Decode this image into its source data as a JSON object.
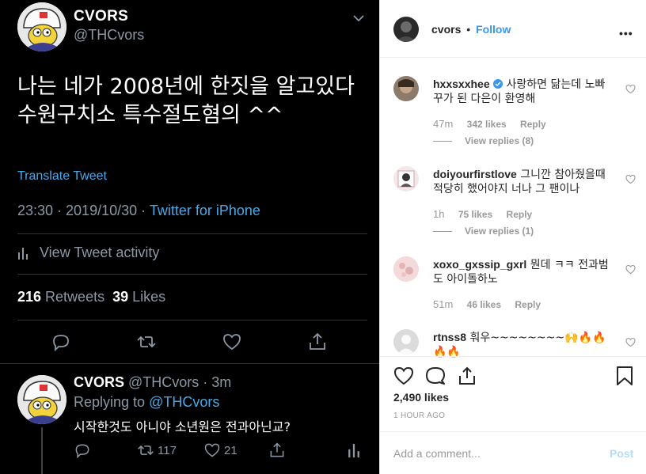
{
  "tweet": {
    "display_name": "CVORS",
    "handle": "@THCvors",
    "text_line1": "나는 네가 2008년에 한짓을 알고있다",
    "text_line2": "수원구치소 특수절도혐의 ^^",
    "translate": "Translate Tweet",
    "timestamp": "23:30 · 2019/10/30 · ",
    "source": "Twitter for iPhone",
    "activity": "View Tweet activity",
    "retweets_count": "216",
    "retweets_label": " Retweets  ",
    "likes_count": "39",
    "likes_label": " Likes"
  },
  "reply": {
    "display_name": "CVORS",
    "handle_time": " @THCvors · 3m",
    "replying_label": "Replying to ",
    "replying_mention": "@THCvors",
    "text": "시작한것도 아니야 소년원은 전과아닌교?",
    "retweets": "117",
    "likes": "21"
  },
  "instagram": {
    "username": "cvors",
    "separator": "•",
    "follow_label": "Follow",
    "more": "•••",
    "comments": [
      {
        "user": "hxxsxxhee",
        "verified": true,
        "text": "사랑하면 닮는데 노빠꾸가 된 다은이 환영해",
        "time": "47m",
        "likes": "342 likes",
        "reply": "Reply",
        "view_replies": "View replies (8)"
      },
      {
        "user": "doiyourfirstlove",
        "verified": false,
        "text": "그니깐 참아줬을때 적당히 했어야지 너나 그 팬이나",
        "time": "1h",
        "likes": "75 likes",
        "reply": "Reply",
        "view_replies": "View replies (1)"
      },
      {
        "user": "xoxo_gxssip_gxrl",
        "verified": false,
        "text": "뭔데 ㅋㅋ 전과범도 아이돌하노",
        "time": "51m",
        "likes": "46 likes",
        "reply": "Reply",
        "view_replies": ""
      },
      {
        "user": "rtnss8",
        "verified": false,
        "text": "훠우~~~~~~~~🙌🔥🔥🔥🔥",
        "time": "",
        "likes": "",
        "reply": "",
        "view_replies": ""
      }
    ],
    "likes_total": "2,490 likes",
    "posted": "1 HOUR AGO",
    "add_comment_placeholder": "Add a comment...",
    "post_label": "Post"
  },
  "colors": {
    "twitter_bg": "#000000",
    "twitter_link": "#4aa8e8",
    "twitter_muted": "#8b98a5",
    "ig_follow": "#3897f0",
    "ig_post_disabled": "#b3dbff"
  }
}
